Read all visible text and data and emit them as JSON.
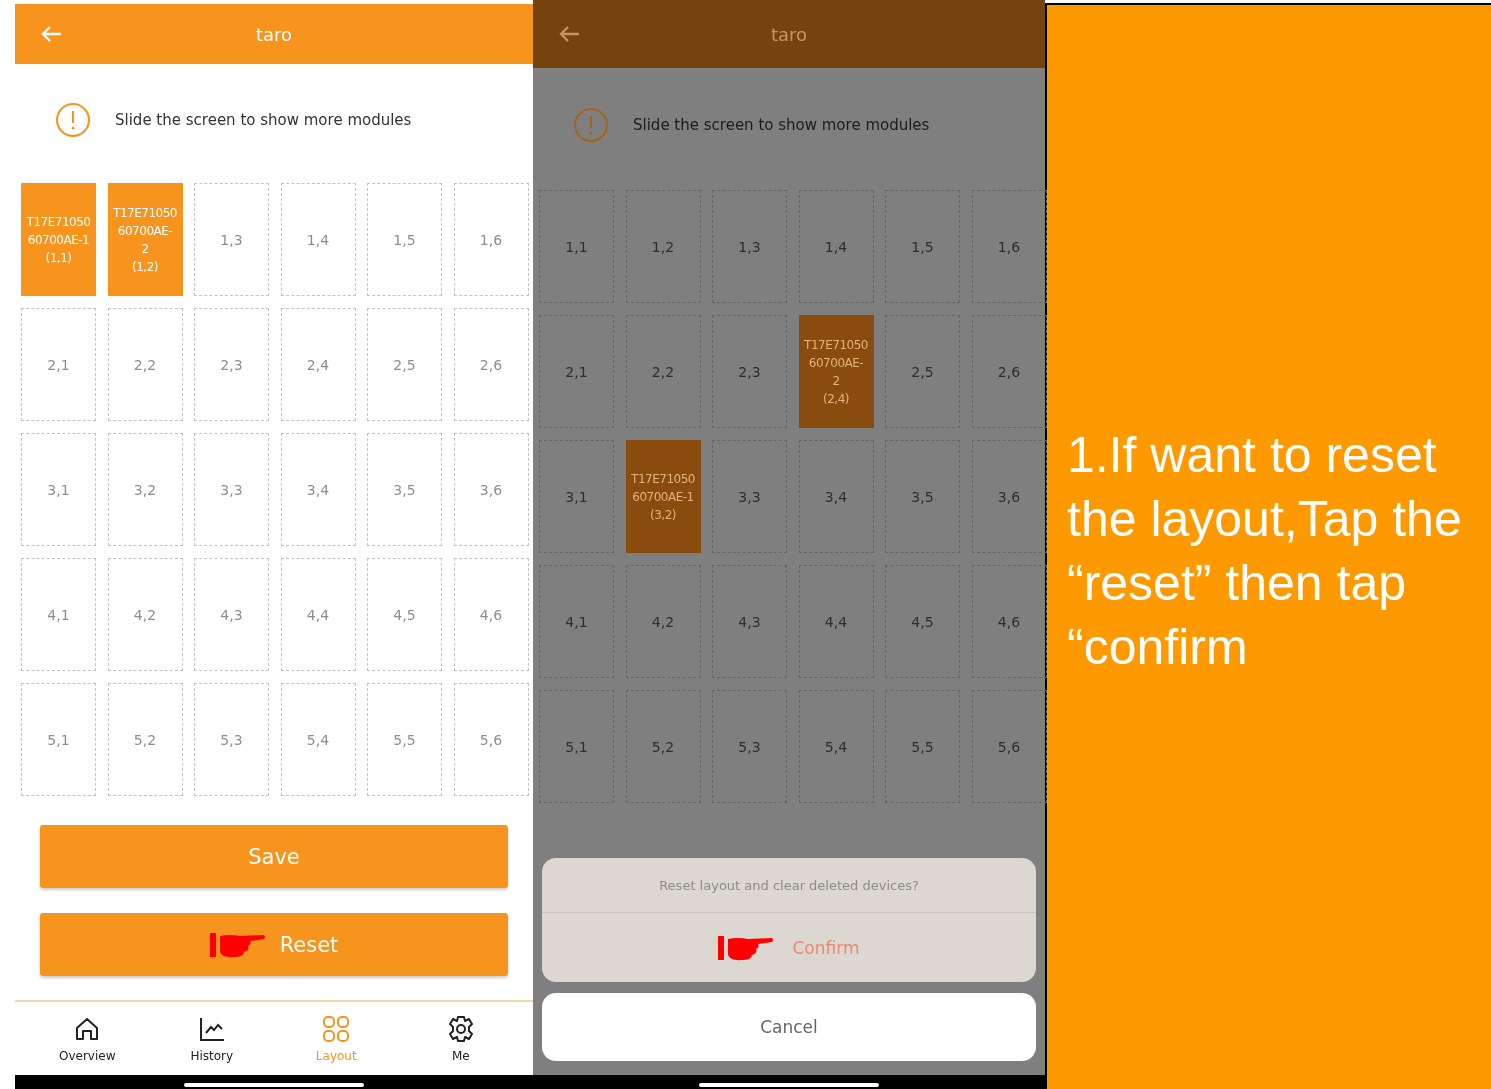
{
  "screens": [
    {
      "title": "taro",
      "dimmed": false,
      "notice": "Slide the screen to show more modules",
      "grid": [
        [
          {
            "kind": "module",
            "text": "T17E71050\n60700AE-1\n(1,1)"
          },
          {
            "kind": "module",
            "text": "T17E71050\n60700AE-\n2\n(1,2)"
          },
          {
            "kind": "empty",
            "text": "1,3"
          },
          {
            "kind": "empty",
            "text": "1,4"
          },
          {
            "kind": "empty",
            "text": "1,5"
          },
          {
            "kind": "empty",
            "text": "1,6"
          }
        ],
        [
          {
            "kind": "empty",
            "text": "2,1"
          },
          {
            "kind": "empty",
            "text": "2,2"
          },
          {
            "kind": "empty",
            "text": "2,3"
          },
          {
            "kind": "empty",
            "text": "2,4"
          },
          {
            "kind": "empty",
            "text": "2,5"
          },
          {
            "kind": "empty",
            "text": "2,6"
          }
        ],
        [
          {
            "kind": "empty",
            "text": "3,1"
          },
          {
            "kind": "empty",
            "text": "3,2"
          },
          {
            "kind": "empty",
            "text": "3,3"
          },
          {
            "kind": "empty",
            "text": "3,4"
          },
          {
            "kind": "empty",
            "text": "3,5"
          },
          {
            "kind": "empty",
            "text": "3,6"
          }
        ],
        [
          {
            "kind": "empty",
            "text": "4,1"
          },
          {
            "kind": "empty",
            "text": "4,2"
          },
          {
            "kind": "empty",
            "text": "4,3"
          },
          {
            "kind": "empty",
            "text": "4,4"
          },
          {
            "kind": "empty",
            "text": "4,5"
          },
          {
            "kind": "empty",
            "text": "4,6"
          }
        ],
        [
          {
            "kind": "empty",
            "text": "5,1"
          },
          {
            "kind": "empty",
            "text": "5,2"
          },
          {
            "kind": "empty",
            "text": "5,3"
          },
          {
            "kind": "empty",
            "text": "5,4"
          },
          {
            "kind": "empty",
            "text": "5,5"
          },
          {
            "kind": "empty",
            "text": "5,6"
          }
        ]
      ],
      "buttons": [
        {
          "label": "Save",
          "pointer": false
        },
        {
          "label": "Reset",
          "pointer": true
        }
      ],
      "nav": [
        {
          "label": "Overview",
          "kind": "home",
          "selected": false
        },
        {
          "label": "History",
          "kind": "chart",
          "selected": false
        },
        {
          "label": "Layout",
          "kind": "grid",
          "selected": true
        },
        {
          "label": "Me",
          "kind": "gear",
          "selected": false
        }
      ]
    },
    {
      "title": "taro",
      "dimmed": true,
      "notice": "Slide the screen to show more modules",
      "grid": [
        [
          {
            "kind": "empty",
            "text": "1,1"
          },
          {
            "kind": "empty",
            "text": "1,2"
          },
          {
            "kind": "empty",
            "text": "1,3"
          },
          {
            "kind": "empty",
            "text": "1,4"
          },
          {
            "kind": "empty",
            "text": "1,5"
          },
          {
            "kind": "empty",
            "text": "1,6"
          }
        ],
        [
          {
            "kind": "empty",
            "text": "2,1"
          },
          {
            "kind": "empty",
            "text": "2,2"
          },
          {
            "kind": "empty",
            "text": "2,3"
          },
          {
            "kind": "module",
            "text": "T17E71050\n60700AE-\n2\n(2,4)"
          },
          {
            "kind": "empty",
            "text": "2,5"
          },
          {
            "kind": "empty",
            "text": "2,6"
          }
        ],
        [
          {
            "kind": "empty",
            "text": "3,1"
          },
          {
            "kind": "module",
            "text": "T17E71050\n60700AE-1\n(3,2)"
          },
          {
            "kind": "empty",
            "text": "3,3"
          },
          {
            "kind": "empty",
            "text": "3,4"
          },
          {
            "kind": "empty",
            "text": "3,5"
          },
          {
            "kind": "empty",
            "text": "3,6"
          }
        ],
        [
          {
            "kind": "empty",
            "text": "4,1"
          },
          {
            "kind": "empty",
            "text": "4,2"
          },
          {
            "kind": "empty",
            "text": "4,3"
          },
          {
            "kind": "empty",
            "text": "4,4"
          },
          {
            "kind": "empty",
            "text": "4,5"
          },
          {
            "kind": "empty",
            "text": "4,6"
          }
        ],
        [
          {
            "kind": "empty",
            "text": "5,1"
          },
          {
            "kind": "empty",
            "text": "5,2"
          },
          {
            "kind": "empty",
            "text": "5,3"
          },
          {
            "kind": "empty",
            "text": "5,4"
          },
          {
            "kind": "empty",
            "text": "5,5"
          },
          {
            "kind": "empty",
            "text": "5,6"
          }
        ]
      ],
      "dialog": {
        "message": "Reset layout and clear deleted devices?",
        "confirm": {
          "label": "Confirm",
          "pointer": true
        },
        "cancel": "Cancel"
      }
    }
  ],
  "instruction": "1.If want to reset the layout,Tap the “reset” then tap “confirm"
}
